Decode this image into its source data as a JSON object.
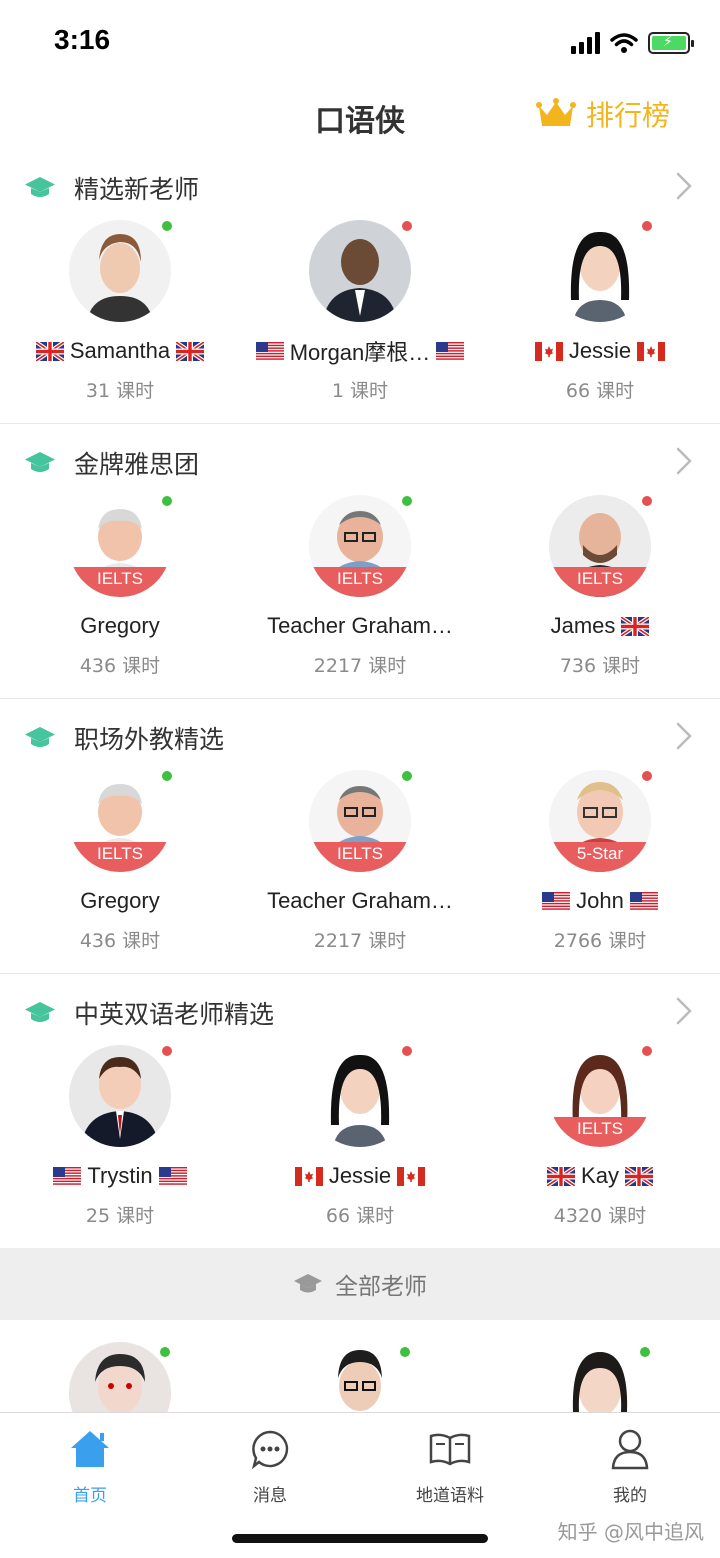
{
  "status_bar": {
    "time": "3:16"
  },
  "header": {
    "title": "口语侠",
    "ranking_label": "排行榜"
  },
  "sections": [
    {
      "title": "精选新老师",
      "teachers": [
        {
          "name": "Samantha",
          "hours": "31 课时",
          "flag": "uk",
          "online": true,
          "badge": ""
        },
        {
          "name": "Morgan摩根…",
          "hours": "1 课时",
          "flag": "us",
          "online": false,
          "badge": ""
        },
        {
          "name": "Jessie",
          "hours": "66 课时",
          "flag": "ca",
          "online": false,
          "badge": ""
        }
      ]
    },
    {
      "title": "金牌雅思团",
      "teachers": [
        {
          "name": "Gregory",
          "hours": "436 课时",
          "flag": "",
          "online": true,
          "badge": "IELTS"
        },
        {
          "name": "Teacher Graham…",
          "hours": "2217 课时",
          "flag": "",
          "online": true,
          "badge": "IELTS"
        },
        {
          "name": "James",
          "hours": "736 课时",
          "flag": "uk",
          "online": false,
          "badge": "IELTS"
        }
      ]
    },
    {
      "title": "职场外教精选",
      "teachers": [
        {
          "name": "Gregory",
          "hours": "436 课时",
          "flag": "",
          "online": true,
          "badge": "IELTS"
        },
        {
          "name": "Teacher Graham…",
          "hours": "2217 课时",
          "flag": "",
          "online": true,
          "badge": "IELTS"
        },
        {
          "name": "John",
          "hours": "2766 课时",
          "flag": "us",
          "online": false,
          "badge": "5-Star"
        }
      ]
    },
    {
      "title": "中英双语老师精选",
      "teachers": [
        {
          "name": "Trystin",
          "hours": "25 课时",
          "flag": "us",
          "online": false,
          "badge": ""
        },
        {
          "name": "Jessie",
          "hours": "66 课时",
          "flag": "ca",
          "online": false,
          "badge": ""
        },
        {
          "name": "Kay",
          "hours": "4320 课时",
          "flag": "uk",
          "online": false,
          "badge": "IELTS"
        }
      ]
    }
  ],
  "all_teachers_label": "全部老师",
  "tabs": [
    {
      "label": "首页",
      "icon": "home-icon",
      "active": true
    },
    {
      "label": "消息",
      "icon": "message-icon",
      "active": false
    },
    {
      "label": "地道语料",
      "icon": "book-icon",
      "active": false
    },
    {
      "label": "我的",
      "icon": "profile-icon",
      "active": false
    }
  ],
  "watermark": "知乎 @风中追风",
  "colors": {
    "accent": "#3aa0ee",
    "online": "#3fbf3f",
    "offline": "#e55050",
    "badge": "#e85d5d",
    "gold": "#f3b51b",
    "cap": "#46c49c"
  }
}
